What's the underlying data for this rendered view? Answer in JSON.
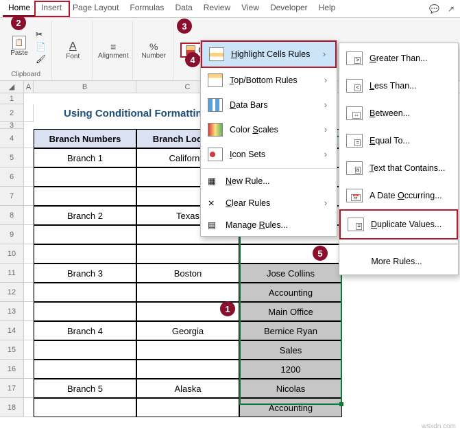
{
  "tabs": [
    "Home",
    "Insert",
    "Page Layout",
    "Formulas",
    "Data",
    "Review",
    "View",
    "Developer",
    "Help"
  ],
  "groups": {
    "clipboard": {
      "paste": "Paste",
      "label": "Clipboard"
    },
    "font": {
      "btn": "Font"
    },
    "alignment": {
      "btn": "Alignment"
    },
    "number": {
      "btn": "Number"
    }
  },
  "cf": {
    "button": "Conditional Formatting",
    "menu": {
      "highlight": "Highlight Cells Rules",
      "topbottom": "Top/Bottom Rules",
      "databars": "Data Bars",
      "colorscales": "Color Scales",
      "iconsets": "Icon Sets",
      "newrule": "New Rule...",
      "clear": "Clear Rules",
      "manage": "Manage Rules..."
    },
    "sub": {
      "gt": "Greater Than...",
      "lt": "Less Than...",
      "bt": "Between...",
      "eq": "Equal To...",
      "tc": "Text that Contains...",
      "dt": "A Date Occurring...",
      "dv": "Duplicate Values...",
      "more": "More Rules..."
    }
  },
  "sheet": {
    "title": "Using Conditional Formatting",
    "headers": {
      "b": "Branch Numbers",
      "c": "Branch Location",
      "d": ""
    },
    "rows": [
      {
        "n": "5",
        "b": "Branch 1",
        "c": "California",
        "d": ""
      },
      {
        "n": "6",
        "b": "",
        "c": "",
        "d": ""
      },
      {
        "n": "7",
        "b": "",
        "c": "",
        "d": ""
      },
      {
        "n": "8",
        "b": "Branch 2",
        "c": "Texas",
        "d": ""
      },
      {
        "n": "9",
        "b": "",
        "c": "",
        "d": ""
      },
      {
        "n": "10",
        "b": "",
        "c": "",
        "d": ""
      },
      {
        "n": "11",
        "b": "Branch 3",
        "c": "Boston",
        "d": "Jose Collins"
      },
      {
        "n": "12",
        "b": "",
        "c": "",
        "d": "Accounting"
      },
      {
        "n": "13",
        "b": "",
        "c": "",
        "d": "Main Office"
      },
      {
        "n": "14",
        "b": "Branch 4",
        "c": "Georgia",
        "d": "Bernice Ryan"
      },
      {
        "n": "15",
        "b": "",
        "c": "",
        "d": "Sales"
      },
      {
        "n": "16",
        "b": "",
        "c": "",
        "d": "1200"
      },
      {
        "n": "17",
        "b": "Branch 5",
        "c": "Alaska",
        "d": "Nicolas"
      },
      {
        "n": "18",
        "b": "",
        "c": "",
        "d": "Accounting"
      }
    ]
  },
  "badges": {
    "1": "1",
    "2": "2",
    "3": "3",
    "4": "4",
    "5": "5"
  },
  "watermark": "wsxdn.com"
}
